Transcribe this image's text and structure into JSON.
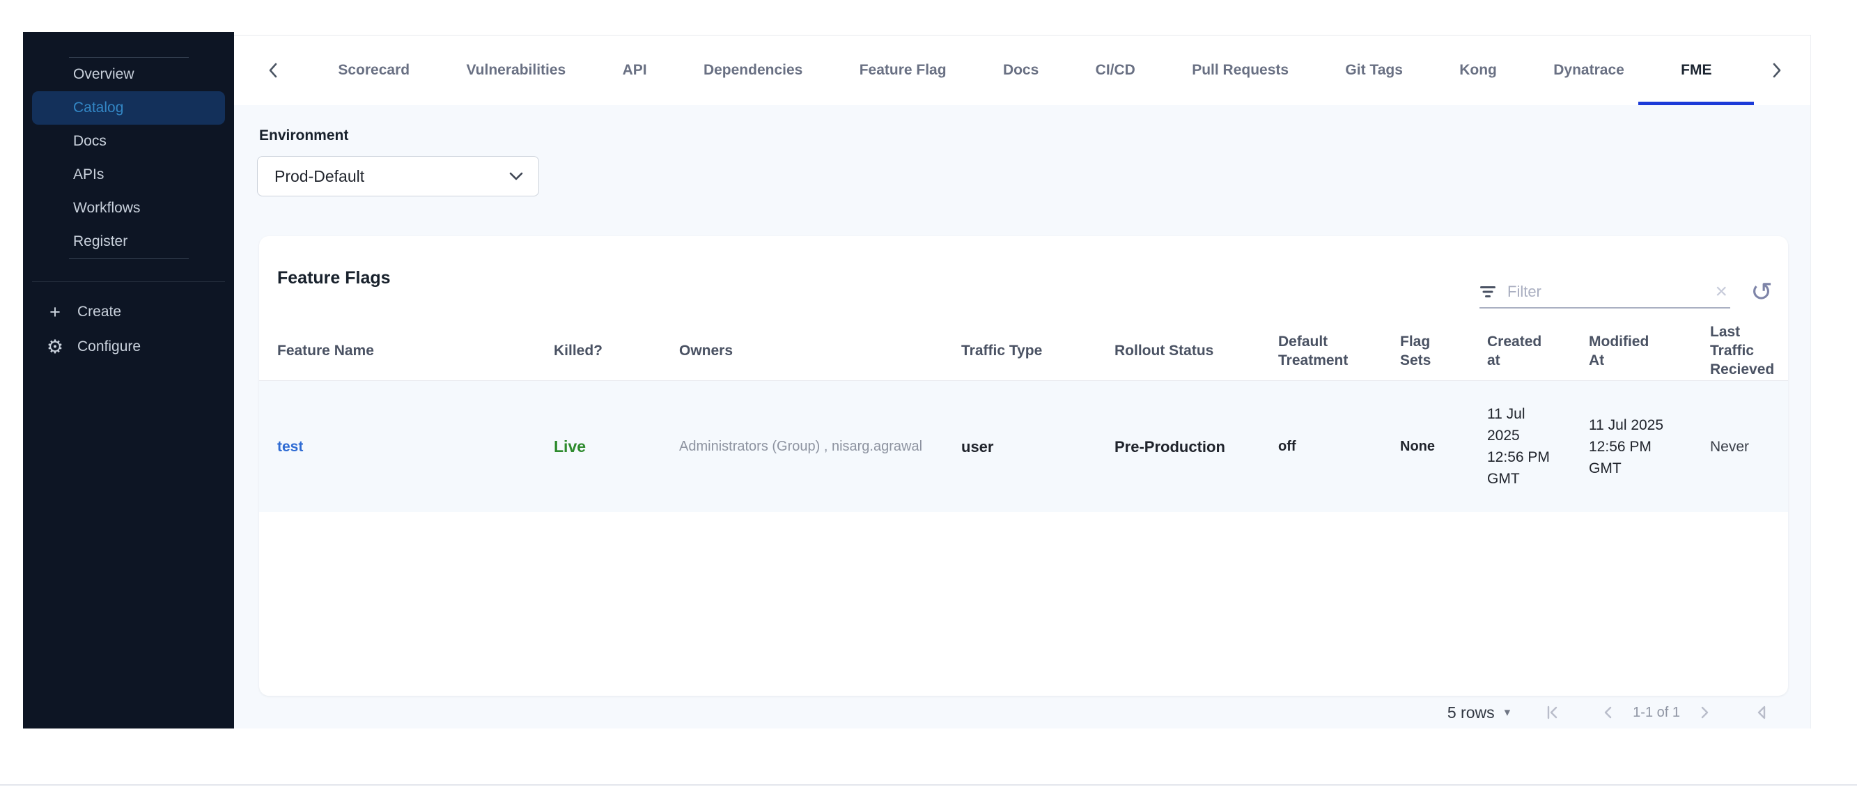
{
  "sidebar": {
    "items": [
      {
        "label": "Overview",
        "active": false
      },
      {
        "label": "Catalog",
        "active": true
      },
      {
        "label": "Docs",
        "active": false
      },
      {
        "label": "APIs",
        "active": false
      },
      {
        "label": "Workflows",
        "active": false
      },
      {
        "label": "Register",
        "active": false
      }
    ],
    "create_label": "Create",
    "configure_label": "Configure"
  },
  "tabs": {
    "items": [
      {
        "label": "Scorecard",
        "active": false
      },
      {
        "label": "Vulnerabilities",
        "active": false
      },
      {
        "label": "API",
        "active": false
      },
      {
        "label": "Dependencies",
        "active": false
      },
      {
        "label": "Feature Flag",
        "active": false
      },
      {
        "label": "Docs",
        "active": false
      },
      {
        "label": "CI/CD",
        "active": false
      },
      {
        "label": "Pull Requests",
        "active": false
      },
      {
        "label": "Git Tags",
        "active": false
      },
      {
        "label": "Kong",
        "active": false
      },
      {
        "label": "Dynatrace",
        "active": false
      },
      {
        "label": "FME",
        "active": true
      }
    ]
  },
  "environment": {
    "label": "Environment",
    "selected": "Prod-Default"
  },
  "feature_flags": {
    "title": "Feature Flags",
    "filter_placeholder": "Filter",
    "columns": [
      "Feature Name",
      "Killed?",
      "Owners",
      "Traffic Type",
      "Rollout Status",
      "Default Treatment",
      "Flag Sets",
      "Created at",
      "Modified At",
      "Last Traffic Recieved"
    ],
    "rows": [
      {
        "feature_name": "test",
        "killed": "Live",
        "owners": "Administrators (Group) , nisarg.agrawal",
        "traffic_type": "user",
        "rollout_status": "Pre-Production",
        "default_treatment": "off",
        "flag_sets": "None",
        "created_at": "11 Jul 2025 12:56 PM GMT",
        "modified_at": "11 Jul 2025 12:56 PM GMT",
        "last_traffic_recieved": "Never"
      }
    ]
  },
  "pagination": {
    "rows_per_page": "5 rows",
    "range": "1-1 of 1"
  },
  "colors": {
    "sidebar_bg": "#0d1524",
    "active_item_bg": "#13305a",
    "active_item_text": "#3386c4",
    "tab_underline": "#1c3bd8",
    "link_blue": "#2e6bd3",
    "live_green": "#2e8b2e",
    "content_bg": "#f6f9fd"
  }
}
